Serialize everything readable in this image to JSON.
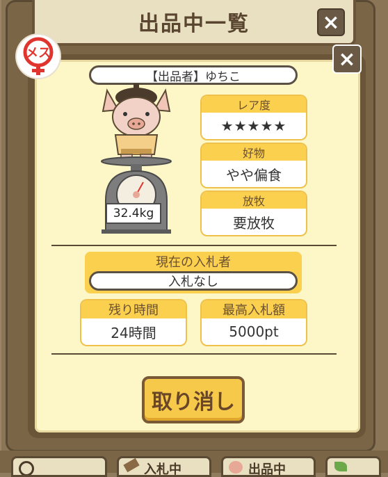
{
  "window": {
    "title": "出品中一覧"
  },
  "popup": {
    "seller_label": "【出品者】ゆちこ",
    "weight": "32.4kg",
    "stats": [
      {
        "label": "レア度",
        "value": "★★★★★"
      },
      {
        "label": "好物",
        "value": "やや偏食"
      },
      {
        "label": "放牧",
        "value": "要放牧"
      }
    ],
    "bidder": {
      "label": "現在の入札者",
      "value": "入札なし"
    },
    "remaining": {
      "label": "残り時間",
      "value": "24時間"
    },
    "top_bid": {
      "label": "最高入札額",
      "value": "5000pt"
    },
    "cancel_label": "取り消し"
  },
  "bottom_tabs": [
    "入札中",
    "出品中"
  ],
  "colors": {
    "panel": "#fdf6c7",
    "accent": "#fbd04f",
    "frame": "#6b5538",
    "female": "#e0352e",
    "stars": "#f08a80"
  }
}
